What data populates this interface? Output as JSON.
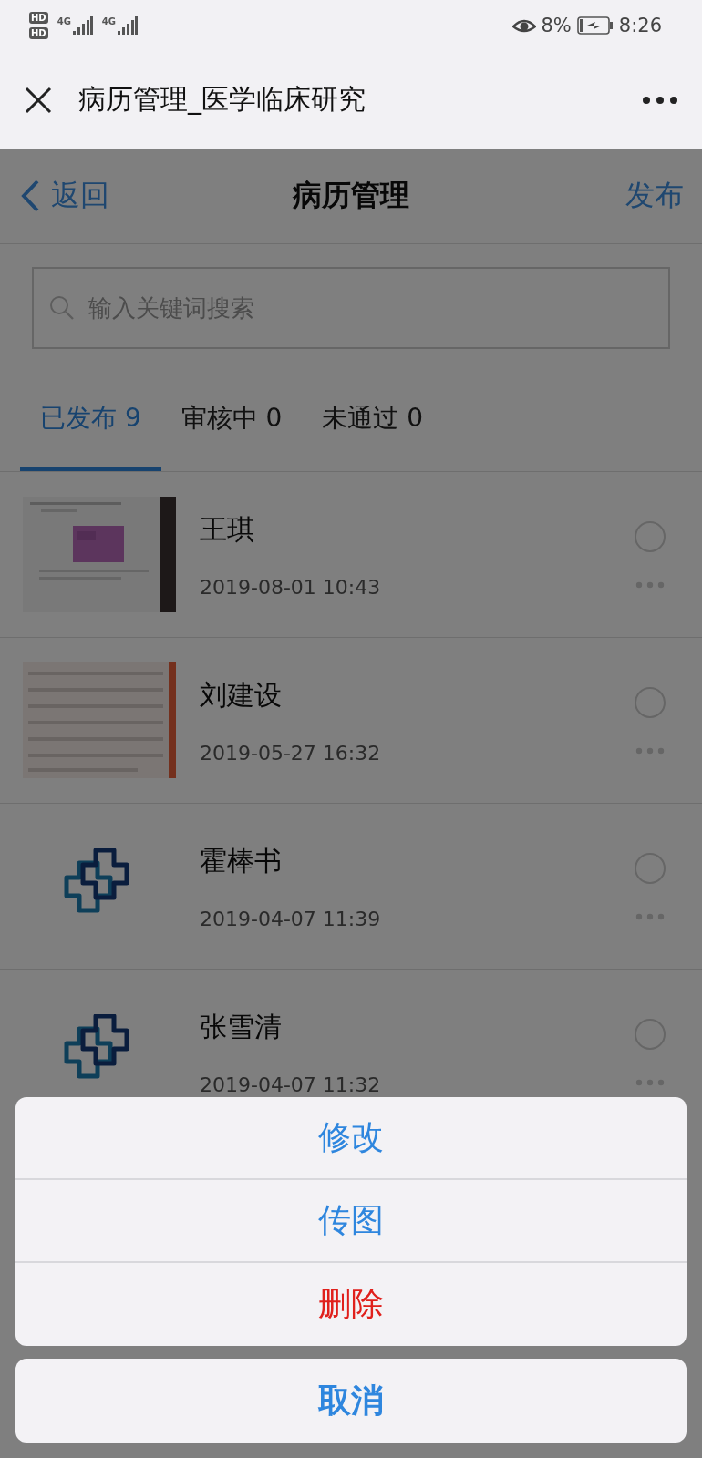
{
  "status_bar": {
    "sim_badges": [
      "HD",
      "HD"
    ],
    "network_types": [
      "4G",
      "4G"
    ],
    "battery": "8%",
    "battery_charging": true,
    "time": "8:26"
  },
  "window": {
    "title": "病历管理_医学临床研究"
  },
  "nav": {
    "back": "返回",
    "title": "病历管理",
    "action": "发布"
  },
  "search": {
    "placeholder": "输入关键词搜索"
  },
  "tabs": [
    {
      "label": "已发布 9",
      "selected": true
    },
    {
      "label": "审核中 0",
      "selected": false
    },
    {
      "label": "未通过 0",
      "selected": false
    }
  ],
  "records": [
    {
      "name": "王琪",
      "date": "2019-08-01 10:43",
      "checked": false
    },
    {
      "name": "刘建设",
      "date": "2019-05-27 16:32",
      "checked": false
    },
    {
      "name": "霍棒书",
      "date": "2019-04-07 11:39",
      "kind": "logo",
      "checked": false
    },
    {
      "name": "张雪清",
      "date": "2019-04-07 11:32",
      "kind": "logo",
      "checked": false
    }
  ],
  "action_sheet": {
    "actions": [
      {
        "label": "修改",
        "kind": "normal"
      },
      {
        "label": "传图",
        "kind": "normal"
      },
      {
        "label": "删除",
        "kind": "destructive"
      }
    ],
    "cancel": "取消"
  }
}
